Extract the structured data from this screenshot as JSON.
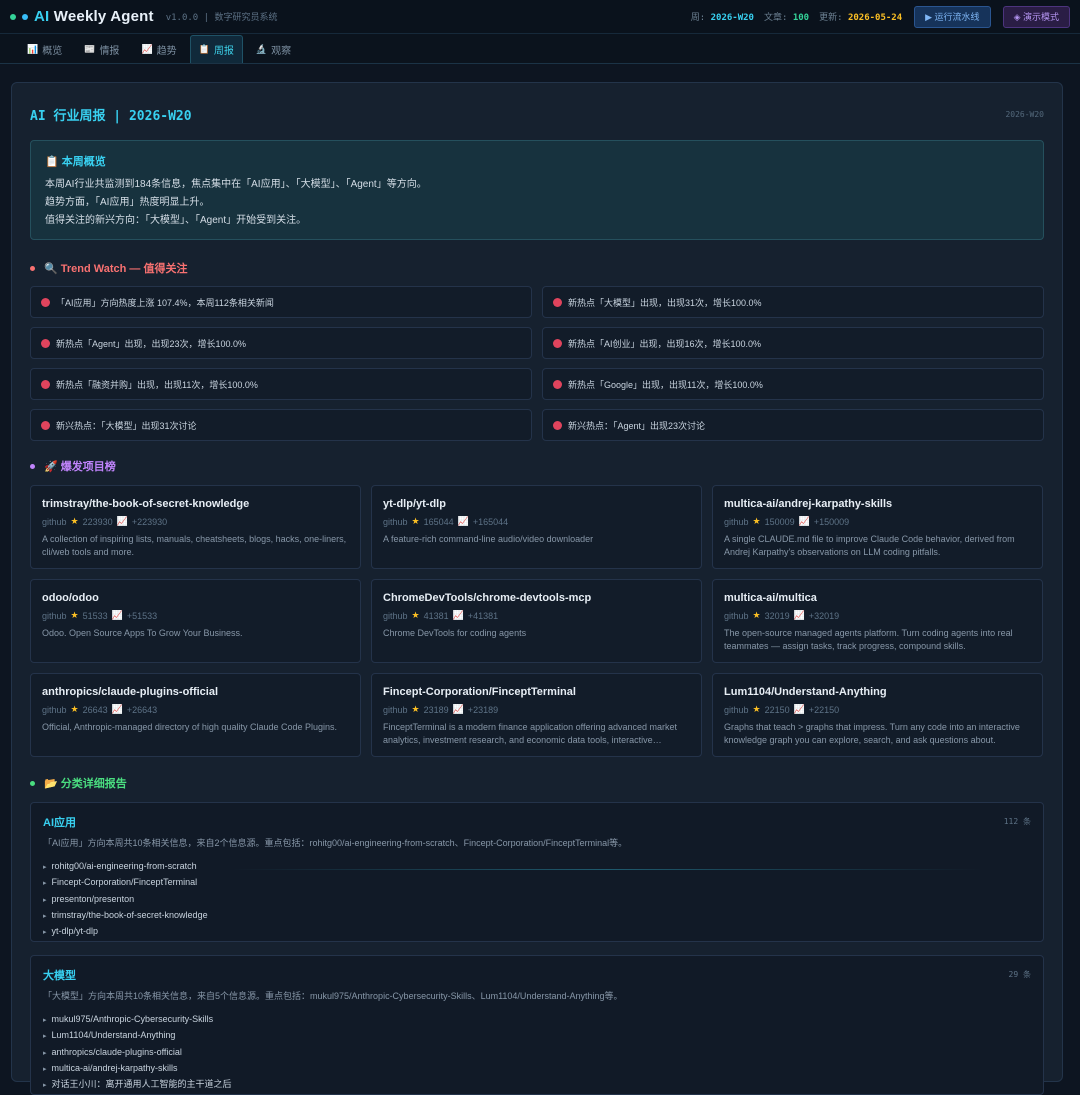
{
  "header": {
    "brand_ai": "AI",
    "brand_rest": " Weekly Agent",
    "version": "v1.0.0 | 数字研究员系统",
    "week_label": "周:",
    "week_value": "2026-W20",
    "articles_label": "文章:",
    "articles_value": "100",
    "updated_label": "更新:",
    "updated_value": "2026-05-24",
    "run_button": "▶ 运行流水线",
    "demo_button": "◈ 演示模式"
  },
  "tabs": [
    {
      "icon": "📊",
      "label": "概览"
    },
    {
      "icon": "📰",
      "label": "情报"
    },
    {
      "icon": "📈",
      "label": "趋势"
    },
    {
      "icon": "📋",
      "label": "周报"
    },
    {
      "icon": "🔬",
      "label": "观察"
    }
  ],
  "report": {
    "title": "AI 行业周报 | 2026-W20",
    "week": "2026-W20",
    "summary_title": "📋 本周概览",
    "summary_lines": [
      "本周AI行业共监测到184条信息，焦点集中在「AI应用」、「大模型」、「Agent」等方向。",
      "趋势方面，「AI应用」热度明显上升。",
      "值得关注的新兴方向：「大模型」、「Agent」开始受到关注。"
    ]
  },
  "trend_watch": {
    "title": "🔍 Trend Watch — 值得关注",
    "items": [
      "「AI应用」方向热度上涨 107.4%，本周112条相关新闻",
      "新热点「大模型」出现，出现31次，增长100.0%",
      "新热点「Agent」出现，出现23次，增长100.0%",
      "新热点「AI创业」出现，出现16次，增长100.0%",
      "新热点「融资并购」出现，出现11次，增长100.0%",
      "新热点「Google」出现，出现11次，增长100.0%",
      "新兴热点：「大模型」出现31次讨论",
      "新兴热点：「Agent」出现23次讨论"
    ]
  },
  "projects": {
    "title": "🚀 爆发项目榜",
    "items": [
      {
        "name": "trimstray/the-book-of-secret-knowledge",
        "source": "github",
        "stars": "223930",
        "growth": "+223930",
        "desc": "A collection of inspiring lists, manuals, cheatsheets, blogs, hacks, one-liners, cli/web tools and more."
      },
      {
        "name": "yt-dlp/yt-dlp",
        "source": "github",
        "stars": "165044",
        "growth": "+165044",
        "desc": "A feature-rich command-line audio/video downloader"
      },
      {
        "name": "multica-ai/andrej-karpathy-skills",
        "source": "github",
        "stars": "150009",
        "growth": "+150009",
        "desc": "A single CLAUDE.md file to improve Claude Code behavior, derived from Andrej Karpathy's observations on LLM coding pitfalls."
      },
      {
        "name": "odoo/odoo",
        "source": "github",
        "stars": "51533",
        "growth": "+51533",
        "desc": "Odoo. Open Source Apps To Grow Your Business."
      },
      {
        "name": "ChromeDevTools/chrome-devtools-mcp",
        "source": "github",
        "stars": "41381",
        "growth": "+41381",
        "desc": "Chrome DevTools for coding agents"
      },
      {
        "name": "multica-ai/multica",
        "source": "github",
        "stars": "32019",
        "growth": "+32019",
        "desc": "The open-source managed agents platform. Turn coding agents into real teammates — assign tasks, track progress, compound skills."
      },
      {
        "name": "anthropics/claude-plugins-official",
        "source": "github",
        "stars": "26643",
        "growth": "+26643",
        "desc": "Official, Anthropic-managed directory of high quality Claude Code Plugins."
      },
      {
        "name": "Fincept-Corporation/FinceptTerminal",
        "source": "github",
        "stars": "23189",
        "growth": "+23189",
        "desc": "FinceptTerminal is a modern finance application offering advanced market analytics, investment research, and economic data tools, interactive exploration and more."
      },
      {
        "name": "Lum1104/Understand-Anything",
        "source": "github",
        "stars": "22150",
        "growth": "+22150",
        "desc": "Graphs that teach > graphs that impress. Turn any code into an interactive knowledge graph you can explore, search, and ask questions about."
      }
    ]
  },
  "categories": {
    "title": "📂 分类详细报告",
    "items": [
      {
        "name": "AI应用",
        "count": "112 条",
        "summary": "「AI应用」方向本周共10条相关信息，来自2个信息源。重点包括：rohitg00/ai-engineering-from-scratch、Fincept-Corporation/FinceptTerminal等。",
        "entries": [
          "rohitg00/ai-engineering-from-scratch",
          "Fincept-Corporation/FinceptTerminal",
          "presenton/presenton",
          "trimstray/the-book-of-secret-knowledge",
          "yt-dlp/yt-dlp"
        ]
      },
      {
        "name": "大模型",
        "count": "29 条",
        "summary": "「大模型」方向本周共10条相关信息，来自5个信息源。重点包括：mukul975/Anthropic-Cybersecurity-Skills、Lum1104/Understand-Anything等。",
        "entries": [
          "mukul975/Anthropic-Cybersecurity-Skills",
          "Lum1104/Understand-Anything",
          "anthropics/claude-plugins-official",
          "multica-ai/andrej-karpathy-skills",
          "对话王小川：离开通用人工智能的主干道之后"
        ]
      }
    ]
  },
  "colors": {
    "accent": "#38d0f0",
    "trend": "#f87171",
    "projects": "#c084fc",
    "categories": "#4ade80"
  }
}
